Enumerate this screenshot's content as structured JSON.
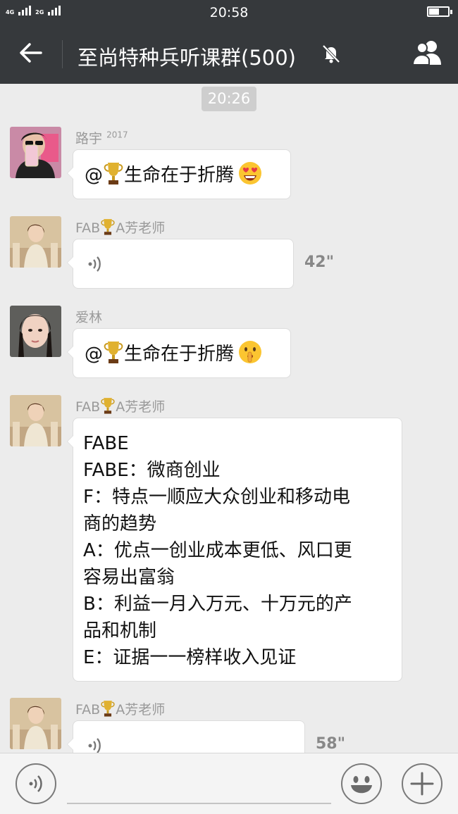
{
  "status_bar": {
    "network_1": "4G",
    "network_1b": "4G",
    "network_2": "2G",
    "time": "20:58"
  },
  "nav": {
    "title": "至尚特种兵听课群(500)",
    "icons": [
      "back-arrow-icon",
      "mute-bell-icon",
      "group-members-icon"
    ]
  },
  "chat": {
    "timestamp": "20:26",
    "messages": [
      {
        "sender": "路宇",
        "sender_sup": "2017",
        "type": "text",
        "mention": "@",
        "text": "生命在于折腾",
        "emoji": "heart-eyes-emoji"
      },
      {
        "sender_prefix": "FAB",
        "sender_suffix": "A芳老师",
        "type": "voice",
        "duration": "42\""
      },
      {
        "sender": "爱林",
        "type": "text",
        "mention": "@",
        "text": "生命在于折腾",
        "emoji": "shushing-face-emoji"
      },
      {
        "sender_prefix": "FAB",
        "sender_suffix": "A芳老师",
        "type": "text",
        "lines": [
          "FABE",
          "FABE：微商创业",
          "F：特点一顺应大众创业和移动电",
          "商的趋势",
          "A：优点一创业成本更低、风口更",
          "容易出富翁",
          "B：利益一月入万元、十万元的产",
          "品和机制",
          "E：证据一一榜样收入见证"
        ]
      },
      {
        "sender_prefix": "FAB",
        "sender_suffix": "A芳老师",
        "type": "voice",
        "duration": "58\""
      }
    ]
  },
  "bottom_bar": {
    "icons": [
      "voice-input-icon",
      "emoji-icon",
      "plus-icon"
    ]
  }
}
